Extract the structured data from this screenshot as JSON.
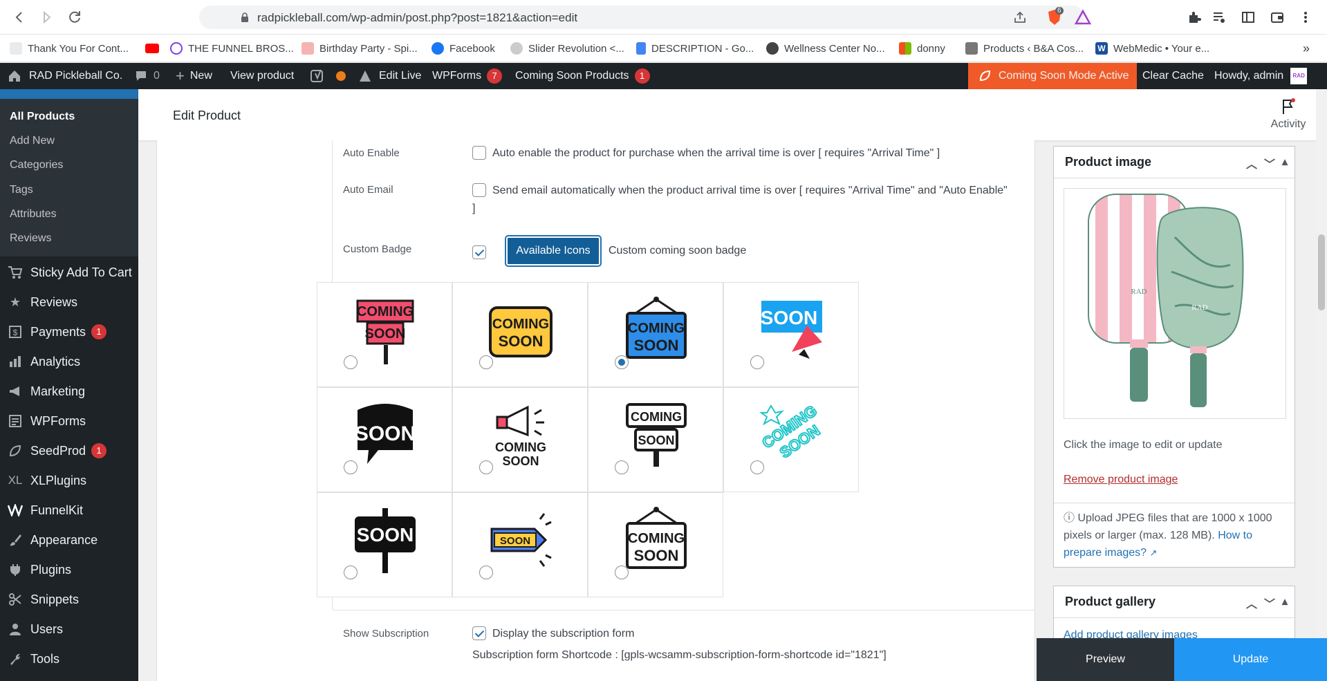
{
  "browser": {
    "url": "radpickleball.com/wp-admin/post.php?post=1821&action=edit",
    "shield_count": "6",
    "bookmarks": [
      "Thank You For Cont...",
      "THE FUNNEL BROS...",
      "Birthday Party - Spi...",
      "Facebook",
      "Slider Revolution <...",
      "DESCRIPTION - Go...",
      "Wellness Center No...",
      "donny",
      "Products ‹ B&A Cos...",
      "WebMedic • Your e..."
    ],
    "more_bookmarks": "»"
  },
  "adminbar": {
    "site_name": "RAD Pickleball Co.",
    "comments_count": "0",
    "new_label": "New",
    "view_product": "View product",
    "edit_live": "Edit Live",
    "wpforms": "WPForms",
    "wpforms_count": "7",
    "coming_soon_products": "Coming Soon Products",
    "coming_soon_count": "1",
    "coming_soon_mode": "Coming Soon Mode Active",
    "clear_cache": "Clear Cache",
    "howdy": "Howdy, admin",
    "avatar_text": "RAD"
  },
  "sidebar": {
    "submenu": [
      "All Products",
      "Add New",
      "Categories",
      "Tags",
      "Attributes",
      "Reviews"
    ],
    "menu": [
      {
        "label": "Sticky Add To Cart",
        "icon": "cart-icon"
      },
      {
        "label": "Reviews",
        "icon": "star-icon"
      },
      {
        "label": "Payments",
        "icon": "payments-icon",
        "badge": "1"
      },
      {
        "label": "Analytics",
        "icon": "analytics-icon"
      },
      {
        "label": "Marketing",
        "icon": "megaphone-icon"
      },
      {
        "label": "WPForms",
        "icon": "forms-icon"
      },
      {
        "label": "SeedProd",
        "icon": "seedprod-icon",
        "badge": "1"
      },
      {
        "label": "XLPlugins",
        "icon": "xl-icon"
      },
      {
        "label": "FunnelKit",
        "icon": "funnelkit-icon"
      },
      {
        "label": "Appearance",
        "icon": "brush-icon"
      },
      {
        "label": "Plugins",
        "icon": "plugin-icon"
      },
      {
        "label": "Snippets",
        "icon": "scissors-icon"
      },
      {
        "label": "Users",
        "icon": "user-icon"
      },
      {
        "label": "Tools",
        "icon": "wrench-icon"
      }
    ]
  },
  "header": {
    "title": "Edit Product",
    "activity": "Activity"
  },
  "form": {
    "auto_enable_label": "Auto Enable",
    "auto_enable_text": "Auto enable the product for purchase when the arrival time is over [ requires \"Arrival Time\" ]",
    "auto_email_label": "Auto Email",
    "auto_email_text": "Send email automatically when the product arrival time is over [ requires \"Arrival Time\" and \"Auto Enable\"",
    "auto_email_text2": "]",
    "custom_badge_label": "Custom Badge",
    "available_icons_btn": "Available Icons",
    "custom_badge_text": "Custom coming soon badge",
    "badges": [
      {
        "style": "pink-sign",
        "line1": "COMING",
        "line2": "SOON",
        "selected": false
      },
      {
        "style": "yellow-box",
        "line1": "COMING",
        "line2": "SOON",
        "selected": false
      },
      {
        "style": "blue-hanging",
        "line1": "COMING",
        "line2": "SOON",
        "selected": true
      },
      {
        "style": "blue-megaphone",
        "line1": "SOON",
        "line2": "",
        "selected": false
      },
      {
        "style": "black-bubble",
        "line1": "SOON",
        "line2": "",
        "selected": false
      },
      {
        "style": "megaphone-text",
        "line1": "COMING",
        "line2": "SOON",
        "selected": false
      },
      {
        "style": "outline-sign",
        "line1": "COMING",
        "line2": "SOON",
        "selected": false
      },
      {
        "style": "teal-script",
        "line1": "COMING",
        "line2": "SOON",
        "selected": false
      },
      {
        "style": "black-post",
        "line1": "SOON",
        "line2": "",
        "selected": false
      },
      {
        "style": "arrow-sign",
        "line1": "SOON",
        "line2": "",
        "selected": false
      },
      {
        "style": "outline-hanging",
        "line1": "COMING",
        "line2": "SOON",
        "selected": false
      }
    ],
    "show_subscription_label": "Show Subscription",
    "show_subscription_text": "Display the subscription form",
    "shortcode_text": "Subscription form Shortcode : [gpls-wcsamm-subscription-form-shortcode id=\"1821\"]"
  },
  "product_image": {
    "title": "Product image",
    "hint": "Click the image to edit or update",
    "remove": "Remove product image",
    "upload_note": "Upload JPEG files that are 1000 x 1000 pixels or larger (max. 128 MB).",
    "how_to": "How to prepare images?",
    "paddle_text": "RAD"
  },
  "product_gallery": {
    "title": "Product gallery",
    "add_link": "Add product gallery images"
  },
  "actions": {
    "preview": "Preview",
    "update": "Update"
  },
  "colors": {
    "wp_blue": "#2271b1",
    "admin_bar": "#1d2327",
    "coming_soon_orange": "#f05a28",
    "badge_red": "#d63638"
  }
}
